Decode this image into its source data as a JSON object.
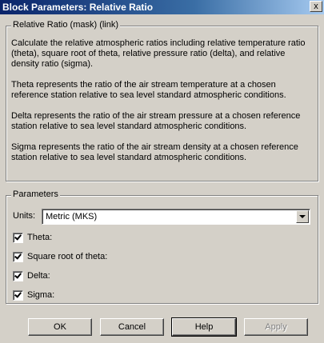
{
  "window": {
    "title": "Block Parameters: Relative Ratio",
    "close_glyph": "x"
  },
  "description": {
    "label": "Relative Ratio (mask) (link)",
    "paragraphs": [
      "Calculate the relative atmospheric ratios including relative temperature ratio (theta), square root of theta, relative pressure ratio (delta), and relative density ratio (sigma).",
      "Theta represents the ratio of the air stream temperature at a chosen reference station relative to sea level standard atmospheric conditions.",
      "Delta represents the ratio of the air stream pressure at a chosen reference station relative to sea level standard atmospheric conditions.",
      "Sigma represents the ratio of the air stream density at a chosen reference station relative to sea level standard atmospheric conditions."
    ]
  },
  "parameters": {
    "label": "Parameters",
    "units_label": "Units:",
    "units_value": "Metric (MKS)",
    "checkboxes": [
      {
        "label": "Theta:",
        "checked": true
      },
      {
        "label": "Square root of theta:",
        "checked": true
      },
      {
        "label": "Delta:",
        "checked": true
      },
      {
        "label": "Sigma:",
        "checked": true
      }
    ]
  },
  "buttons": {
    "ok": "OK",
    "cancel": "Cancel",
    "help": "Help",
    "apply": "Apply"
  }
}
